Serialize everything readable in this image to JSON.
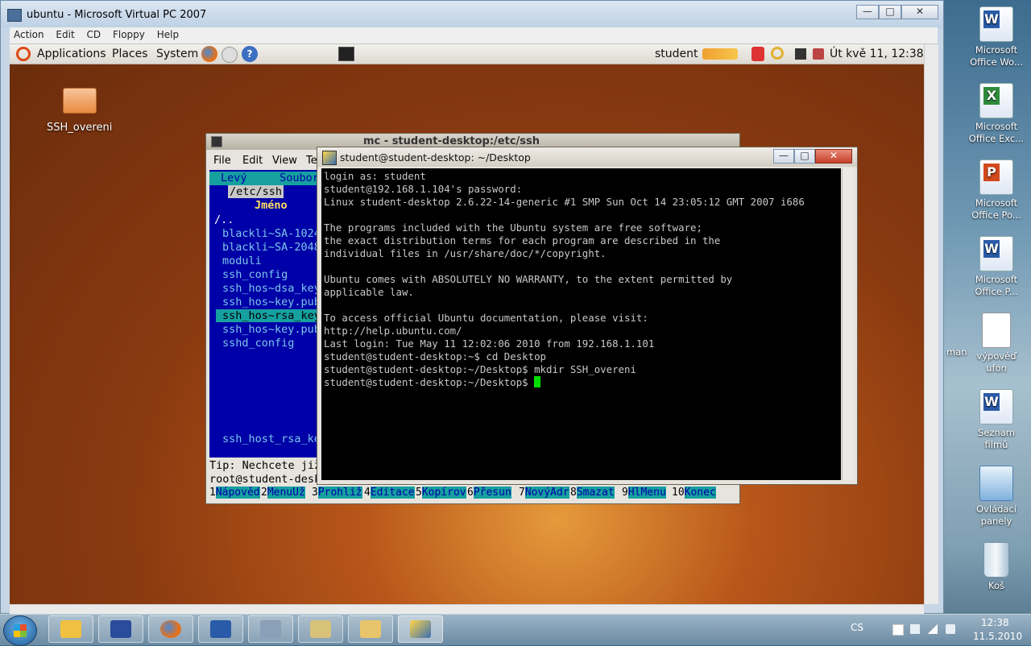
{
  "vpc": {
    "title": "ubuntu - Microsoft Virtual PC 2007",
    "menu": [
      "Action",
      "Edit",
      "CD",
      "Floppy",
      "Help"
    ],
    "controls": {
      "minimize": "—",
      "maximize": "□",
      "close": "✕"
    }
  },
  "guest_panel": {
    "menus": [
      "Applications",
      "Places",
      "System"
    ],
    "user": "student",
    "clock": "Út kvě 11, 12:38"
  },
  "guest_desktop": {
    "folder_label": "SSH_overeni"
  },
  "mc": {
    "title": "mc - student-desktop:/etc/ssh",
    "menu": [
      "File",
      "Edit",
      "View",
      "Te"
    ],
    "panel_header": "Levý     Soubor",
    "path": "/etc/ssh",
    "column": "Jméno",
    "files": [
      "/..",
      "blackli~SA-1024",
      "blackli~SA-2048",
      "moduli",
      "ssh_config",
      "ssh_hos~dsa_key",
      "ssh_hos~key.pub",
      "ssh_hos~rsa_key",
      "ssh_hos~key.pub",
      "sshd_config"
    ],
    "selected_file": "ssh_host_rsa_ke",
    "tip": "Tip: Nechcete již",
    "prompt": "root@student-desk",
    "fkeys": [
      {
        "n": "1",
        "l": "Nápověd"
      },
      {
        "n": "2",
        "l": "MenuUž"
      },
      {
        "n": "3",
        "l": "Prohliž"
      },
      {
        "n": "4",
        "l": "Editace"
      },
      {
        "n": "5",
        "l": "Kopírov"
      },
      {
        "n": "6",
        "l": "Přesun"
      },
      {
        "n": "7",
        "l": "NovýAdr"
      },
      {
        "n": "8",
        "l": "Smazat"
      },
      {
        "n": "9",
        "l": "HlMenu"
      },
      {
        "n": "10",
        "l": "Konec"
      }
    ]
  },
  "ssh": {
    "title": "student@student-desktop: ~/Desktop",
    "lines": [
      "login as: student",
      "student@192.168.1.104's password:",
      "Linux student-desktop 2.6.22-14-generic #1 SMP Sun Oct 14 23:05:12 GMT 2007 i686",
      "",
      "The programs included with the Ubuntu system are free software;",
      "the exact distribution terms for each program are described in the",
      "individual files in /usr/share/doc/*/copyright.",
      "",
      "Ubuntu comes with ABSOLUTELY NO WARRANTY, to the extent permitted by",
      "applicable law.",
      "",
      "To access official Ubuntu documentation, please visit:",
      "http://help.ubuntu.com/",
      "Last login: Tue May 11 12:02:06 2010 from 192.168.1.101",
      "student@student-desktop:~$ cd Desktop",
      "student@student-desktop:~/Desktop$ mkdir SSH_overeni",
      "student@student-desktop:~/Desktop$ "
    ]
  },
  "host_icons": [
    {
      "label": "Microsoft Office Wo...",
      "icon": "word-icon"
    },
    {
      "label": "Microsoft Office Exc...",
      "icon": "excel-icon"
    },
    {
      "label": "Microsoft Office Po...",
      "icon": "powerpoint-icon"
    },
    {
      "label": "Microsoft Office P...",
      "icon": "publisher-icon"
    },
    {
      "label": "výpověď ufon",
      "icon": "document-icon"
    },
    {
      "label": "Seznam filmů",
      "icon": "word-icon"
    },
    {
      "label": "Ovládací panely",
      "icon": "control-panel-icon"
    },
    {
      "label": "Koš",
      "icon": "recycle-bin-icon"
    }
  ],
  "host_partial_label": "man",
  "taskbar": {
    "language": "CS",
    "time": "12:38",
    "date": "11.5.2010"
  }
}
